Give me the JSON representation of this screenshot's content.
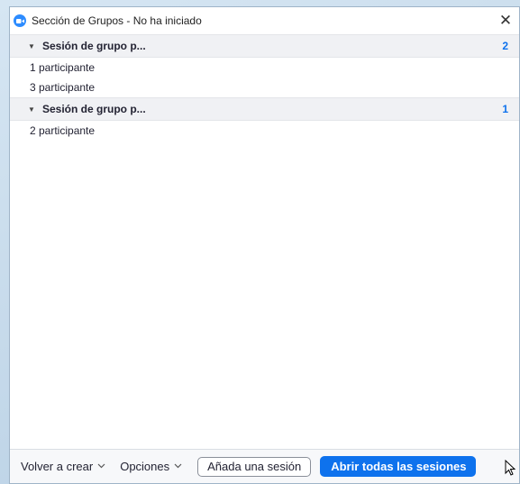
{
  "window": {
    "title": "Sección de Grupos - No ha iniciado",
    "close_symbol": "✕"
  },
  "groups": [
    {
      "name": "Sesión de grupo p...",
      "count": "2",
      "participants": [
        "1 participante",
        "3 participante"
      ]
    },
    {
      "name": "Sesión de grupo p...",
      "count": "1",
      "participants": [
        "2 participante"
      ]
    }
  ],
  "footer": {
    "recreate_label": "Volver a crear",
    "options_label": "Opciones",
    "add_session_label": "Añada una sesión",
    "open_all_label": "Abrir todas las sesiones"
  },
  "icons": {
    "app": "zoom-video-icon",
    "caret": "caret-down-icon",
    "chevron": "chevron-down-icon",
    "close": "close-icon",
    "cursor": "mouse-pointer-icon"
  },
  "colors": {
    "accent": "#0e72ed",
    "header_bg": "#f0f1f4"
  }
}
